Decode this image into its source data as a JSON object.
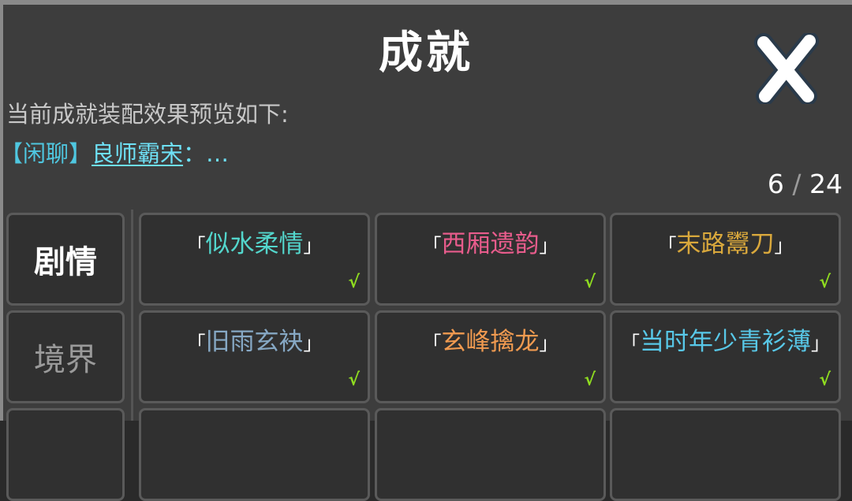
{
  "title": "成就",
  "preview": {
    "label": "当前成就装配效果预览如下:",
    "tag": "【闲聊】",
    "achievement": "良师霸宋",
    "suffix": "：…"
  },
  "counter": {
    "current": "6",
    "separator": "/",
    "total": "24"
  },
  "categories": [
    {
      "label": "剧情",
      "active": true
    },
    {
      "label": "境界",
      "active": false
    }
  ],
  "brackets": {
    "open": "「",
    "close": "」"
  },
  "check_mark": "√",
  "colors": {
    "cyan": "#53d6cc",
    "pink": "#e85c8c",
    "gold": "#d9a83c",
    "steel": "#86a8c4",
    "orange": "#f09a50",
    "sky": "#58c8e8",
    "check": "#8fdc20"
  },
  "achievements": [
    [
      {
        "name": "似水柔情",
        "color": "#53d6cc",
        "checked": true
      },
      {
        "name": "西厢遗韵",
        "color": "#e85c8c",
        "checked": true
      },
      {
        "name": "末路鬻刀",
        "color": "#d9a83c",
        "checked": true
      }
    ],
    [
      {
        "name": "旧雨玄袂",
        "color": "#86a8c4",
        "checked": true
      },
      {
        "name": "玄峰擒龙",
        "color": "#f09a50",
        "checked": true
      },
      {
        "name": "当时年少青衫薄",
        "color": "#58c8e8",
        "checked": true
      }
    ]
  ]
}
